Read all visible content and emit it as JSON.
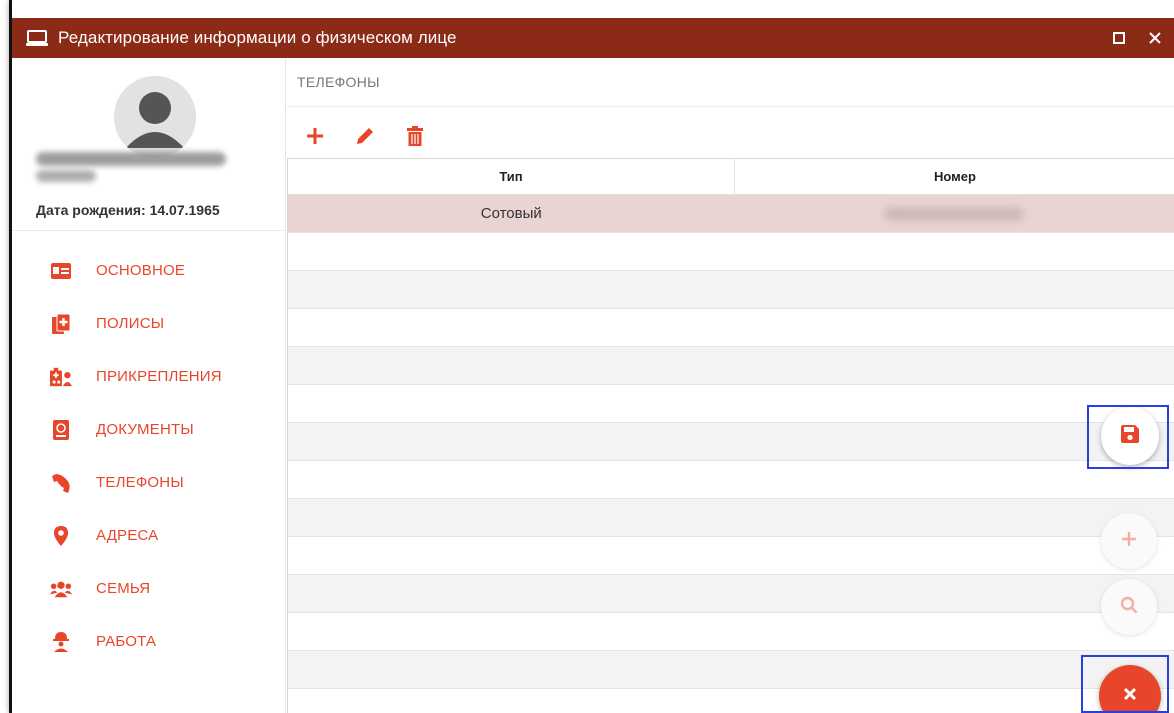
{
  "window": {
    "title": "Редактирование информации о физическом лице",
    "controls": {
      "maximize_icon": "maximize-icon",
      "close_icon": "close-icon"
    }
  },
  "colors": {
    "titlebar": "#8b2a16",
    "accent": "#e8462a",
    "selected_row": "#ead3d3",
    "highlight_box": "#2a3ee6"
  },
  "person": {
    "birth_label": "Дата рождения: 14.07.1965"
  },
  "sidebar": {
    "items": [
      {
        "label": "ОСНОВНОЕ",
        "icon": "id-card-icon"
      },
      {
        "label": "ПОЛИСЫ",
        "icon": "medical-file-icon"
      },
      {
        "label": "ПРИКРЕПЛЕНИЯ",
        "icon": "hospital-user-icon"
      },
      {
        "label": "ДОКУМЕНТЫ",
        "icon": "passport-icon"
      },
      {
        "label": "ТЕЛЕФОНЫ",
        "icon": "phone-icon"
      },
      {
        "label": "АДРЕСА",
        "icon": "map-marker-icon"
      },
      {
        "label": "СЕМЬЯ",
        "icon": "users-icon"
      },
      {
        "label": "РАБОТА",
        "icon": "worker-icon"
      }
    ]
  },
  "section": {
    "title": "ТЕЛЕФОНЫ",
    "toolbar": {
      "add_icon": "plus-icon",
      "edit_icon": "pencil-icon",
      "delete_icon": "trash-icon"
    }
  },
  "table": {
    "columns": [
      "Тип",
      "Номер"
    ],
    "rows": [
      {
        "type": "Сотовый"
      }
    ]
  },
  "fabs": {
    "save_icon": "save-icon",
    "add_icon": "plus-icon",
    "search_icon": "search-icon",
    "close_icon": "close-icon"
  }
}
